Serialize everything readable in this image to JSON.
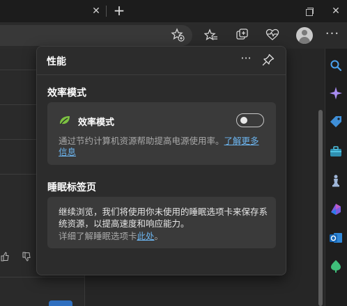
{
  "browser": {
    "tab_close_glyph": "✕",
    "new_tab_glyph": "+",
    "window_close_glyph": "✕",
    "more_glyph": "···"
  },
  "popup": {
    "title": "性能",
    "more_glyph": "···",
    "efficiency": {
      "section_title": "效率模式",
      "toggle_label": "效率模式",
      "toggle_on": false,
      "description": "通过节约计算机资源帮助提高电源使用率。",
      "learn_more": "了解更多信息"
    },
    "sleeping_tabs": {
      "section_title": "睡眠标签页",
      "description": "继续浏览，我们将使用你未使用的睡眠选项卡来保存系统资源，以提高速度和响应能力。",
      "more_prefix": "详细了解睡眠选项卡",
      "more_link": "此处",
      "more_suffix": "。"
    }
  },
  "colors": {
    "accent_link": "#6cb4ee",
    "leaf_green": "#7cc242"
  }
}
